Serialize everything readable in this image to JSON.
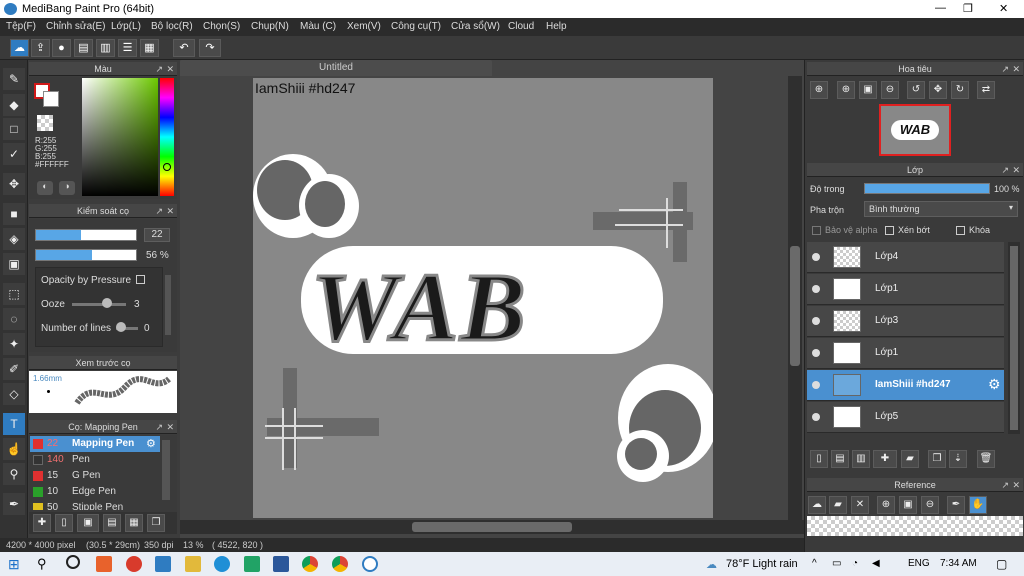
{
  "window": {
    "title": "MediBang Paint Pro (64bit)",
    "min": "—",
    "max": "❐",
    "close": "✕"
  },
  "menu": [
    "Tệp(F)",
    "Chỉnh sửa(E)",
    "Lớp(L)",
    "Bộ lọc(R)",
    "Chọn(S)",
    "Chụp(N)",
    "Màu (C)",
    "Xem(V)",
    "Công cụ(T)",
    "Cửa sổ(W)",
    "Cloud",
    "Help"
  ],
  "color_panel": {
    "title": "Màu",
    "r": "R:255",
    "g": "G:255",
    "b": "B:255",
    "hex": "#FFFFFF"
  },
  "brush_control": {
    "title": "Kiểm soát cọ",
    "size": "22",
    "opacity": "56 %",
    "opacity_by_pressure": "Opacity by Pressure",
    "ooze_label": "Ooze",
    "ooze_value": "3",
    "lines_label": "Number of lines",
    "lines_value": "0"
  },
  "brush_preview": {
    "title": "Xem trước cọ",
    "size_label": "1.66mm"
  },
  "brush_list": {
    "title": "Cọ: Mapping Pen",
    "items": [
      {
        "num": "22",
        "name": "Mapping Pen",
        "color": "#e03030"
      },
      {
        "num": "140",
        "name": "Pen",
        "color": "#333333"
      },
      {
        "num": "15",
        "name": "G Pen",
        "color": "#e03030"
      },
      {
        "num": "10",
        "name": "Edge Pen",
        "color": "#2aa02a"
      },
      {
        "num": "50",
        "name": "Stipple Pen",
        "color": "#e0c020"
      }
    ]
  },
  "canvas": {
    "tab": "Untitled",
    "watermark": "IamShiii #hd247",
    "art_text": "WAB"
  },
  "status": {
    "size": "4200 * 4000 pixel",
    "cm": "(30.5 * 29cm)",
    "dpi": "350 dpi",
    "zoom": "13 %",
    "coords": "( 4522, 820 )"
  },
  "navigator": {
    "title": "Hoa tiêu"
  },
  "layers_panel": {
    "title": "Lớp",
    "opacity_label": "Độ trong",
    "opacity_value": "100 %",
    "blend_label": "Pha trộn",
    "blend_value": "Bình thường",
    "protect_alpha": "Bảo vệ alpha",
    "clip": "Xén bớt",
    "lock": "Khóa",
    "layers": [
      {
        "name": "Lớp4",
        "active": false
      },
      {
        "name": "Lớp1",
        "active": false
      },
      {
        "name": "Lớp3",
        "active": false
      },
      {
        "name": "Lớp1",
        "active": false
      },
      {
        "name": "IamShiii #hd247",
        "active": true
      },
      {
        "name": "Lớp5",
        "active": false
      }
    ]
  },
  "reference": {
    "title": "Reference"
  },
  "taskbar": {
    "weather": "78°F  Light rain",
    "lang": "ENG",
    "time": "7:34 AM"
  },
  "colors": {
    "accent": "#4a90d0",
    "active_tool": "#2f7cc1"
  }
}
